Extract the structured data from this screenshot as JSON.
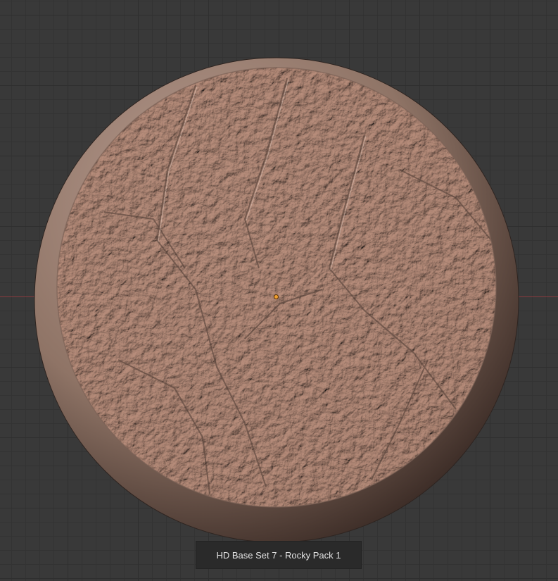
{
  "viewport": {
    "caption": "HD Base Set 7 - Rocky Pack 1"
  },
  "model": {
    "name_icon": "rocky-base-model",
    "rim_color": "#9a7f72",
    "surface_color": "#c4a597",
    "shadow_color": "#5e4a40"
  },
  "grid": {
    "axis_color": "#8a3a3e",
    "background": "#393939"
  }
}
